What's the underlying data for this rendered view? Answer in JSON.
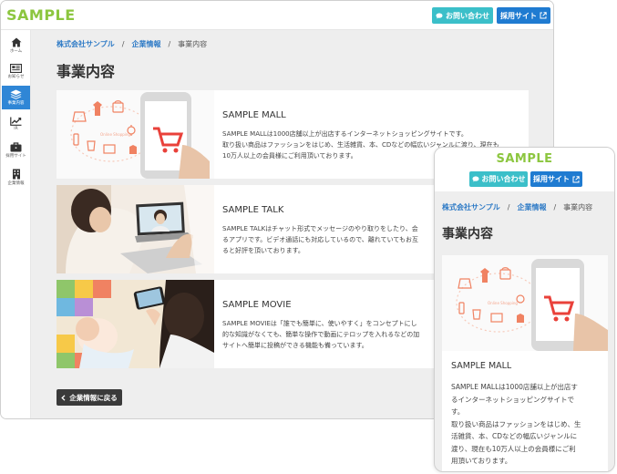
{
  "brand": {
    "logo": "SAMPLE",
    "accent": "#8cc63f",
    "link_color": "#2f7bc6"
  },
  "header": {
    "contact_label": "お問い合わせ",
    "recruit_label": "採用サイト"
  },
  "sidebar": {
    "items": [
      {
        "label": "ホーム",
        "icon": "home-icon"
      },
      {
        "label": "お知らせ",
        "icon": "news-icon"
      },
      {
        "label": "事業内容",
        "icon": "layers-icon",
        "active": true
      },
      {
        "label": "IR",
        "icon": "chart-icon"
      },
      {
        "label": "採用サイト",
        "icon": "briefcase-icon"
      },
      {
        "label": "企業情報",
        "icon": "building-icon"
      }
    ]
  },
  "breadcrumb": {
    "items": [
      "株式会社サンプル",
      "企業情報",
      "事業内容"
    ],
    "separator": "/"
  },
  "page": {
    "title": "事業内容"
  },
  "services": [
    {
      "name": "SAMPLE MALL",
      "desc_lines": [
        "SAMPLE MALLは1000店舗以上が出店するインターネットショッピングサイトです。",
        "取り扱い商品はファッションをはじめ、生活雑貨、本、CDなどの幅広いジャンルに渡り、現在も",
        "10万人以上の会員様にご利用頂いております。"
      ]
    },
    {
      "name": "SAMPLE TALK",
      "desc_lines": [
        "SAMPLE TALKはチャット形式でメッセージのやり取りをしたり、会",
        "るアプリです。ビデオ通話にも対応しているので、離れていてもお互",
        "ると好評を頂いております。"
      ]
    },
    {
      "name": "SAMPLE MOVIE",
      "desc_lines": [
        "SAMPLE MOVIEは「誰でも簡単に、使いやすく」をコンセプトにし",
        "的な知識がなくても、簡単な操作で動画にテロップを入れるなどの加",
        "サイトへ簡単に投稿ができる機能も備っています。"
      ]
    }
  ],
  "back_button": {
    "label": "企業情報に戻る"
  },
  "mobile": {
    "card": {
      "name": "SAMPLE MALL",
      "desc_lines": [
        "SAMPLE MALLは1000店舗以上が出店す",
        "るインターネットショッピングサイトで",
        "す。",
        "取り扱い商品はファッションをはじめ、生",
        "活雑貨、本、CDなどの幅広いジャンルに",
        "渡り、現在も10万人以上の会員様にご利",
        "用頂いております。"
      ]
    }
  }
}
